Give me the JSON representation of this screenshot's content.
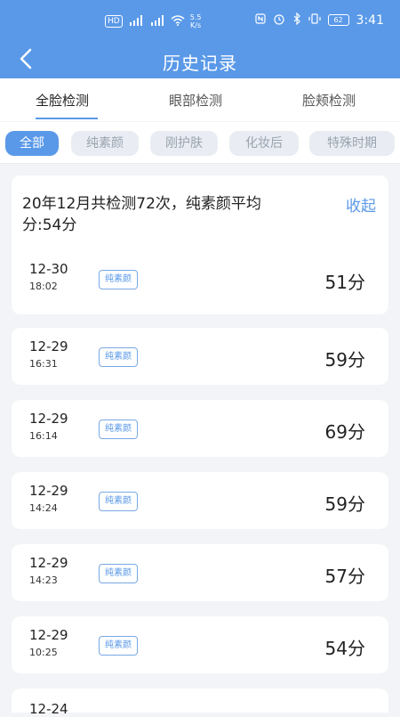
{
  "status_bar": {
    "left_icons": [
      "hd-pill",
      "4g-signal-icon",
      "4g-signal-icon",
      "wifi-icon"
    ],
    "hd_label": "HD",
    "sig1_label": "⁴ᴳ",
    "sig2_label": "⁴ᴳ",
    "speed_top": "5.5",
    "speed_bottom": "K/s",
    "right_icons": [
      "nfc-icon",
      "alarm-icon",
      "bluetooth-icon",
      "vibrate-icon"
    ],
    "battery": "62",
    "time": "3:41"
  },
  "nav": {
    "title": "历史记录"
  },
  "tabs": [
    {
      "label": "全脸检测",
      "active": true
    },
    {
      "label": "眼部检测",
      "active": false
    },
    {
      "label": "脸颊检测",
      "active": false
    }
  ],
  "filters": [
    {
      "label": "全部",
      "active": true
    },
    {
      "label": "纯素颜",
      "active": false
    },
    {
      "label": "刚护肤",
      "active": false
    },
    {
      "label": "化妆后",
      "active": false
    },
    {
      "label": "特殊时期",
      "active": false
    }
  ],
  "summary": {
    "text": "20年12月共检测72次，纯素颜平均分:54分",
    "collapse_label": "收起"
  },
  "records": [
    {
      "date": "12-30",
      "time": "18:02",
      "tag": "纯素颜",
      "score": "51分"
    },
    {
      "date": "12-29",
      "time": "16:31",
      "tag": "纯素颜",
      "score": "59分"
    },
    {
      "date": "12-29",
      "time": "16:14",
      "tag": "纯素颜",
      "score": "69分"
    },
    {
      "date": "12-29",
      "time": "14:24",
      "tag": "纯素颜",
      "score": "59分"
    },
    {
      "date": "12-29",
      "time": "14:23",
      "tag": "纯素颜",
      "score": "57分"
    },
    {
      "date": "12-29",
      "time": "10:25",
      "tag": "纯素颜",
      "score": "54分"
    },
    {
      "date": "12-24",
      "time": "",
      "tag": "",
      "score": ""
    }
  ],
  "colors": {
    "accent": "#5a99e8",
    "background": "#f3f4f8"
  }
}
